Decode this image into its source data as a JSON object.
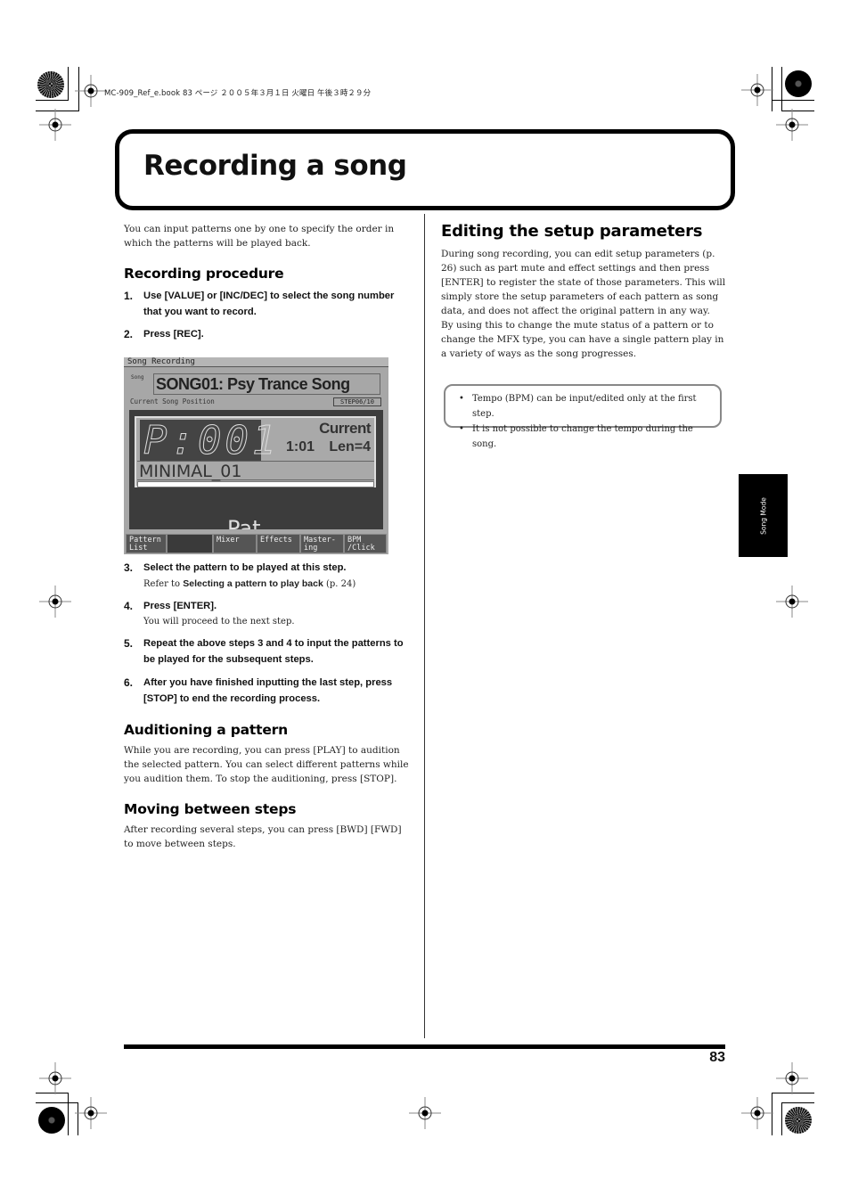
{
  "print_slug": "MC-909_Ref_e.book  83 ページ  ２００５年３月１日  火曜日  午後３時２９分",
  "title": "Recording a song",
  "left_column": {
    "intro": "You can input patterns one by one to specify the order in which the patterns will be played back.",
    "recording_procedure": {
      "heading": "Recording procedure",
      "steps_before_screen": [
        {
          "num": "1.",
          "text": "Use [VALUE] or [INC/DEC] to select the song number that you want to record."
        },
        {
          "num": "2.",
          "text": "Press [REC]."
        }
      ],
      "steps_after_screen": [
        {
          "num": "3.",
          "text": "Select the pattern to be played at this step.",
          "sub_prefix": "Refer to ",
          "sub_bold": "Selecting a pattern to play back",
          "sub_suffix": " (p. 24)"
        },
        {
          "num": "4.",
          "text": "Press [ENTER].",
          "sub": "You will proceed to the next step."
        },
        {
          "num": "5.",
          "text": "Repeat the above steps 3 and 4 to input the patterns to be played for the subsequent steps."
        },
        {
          "num": "6.",
          "text": "After you have finished inputting the last step, press [STOP] to end the recording process."
        }
      ]
    },
    "auditioning": {
      "heading": "Auditioning a pattern",
      "body": "While you are recording, you can press [PLAY] to audition the selected pattern. You can select different patterns while you audition them. To stop the auditioning, press [STOP]."
    },
    "moving": {
      "heading": "Moving between steps",
      "body": "After recording several steps, you can press [BWD] [FWD] to move between steps."
    }
  },
  "screen": {
    "header": "Song Recording",
    "song_label": "Song",
    "song_name": "SONG01: Psy Trance Song",
    "position_label": "Current Song Position",
    "step": "STEP06/10",
    "pattern_number": "P:001",
    "current_label": "Current",
    "measure_position": "1:01",
    "length": "Len=4",
    "pattern_name": "MINIMAL_01",
    "tabs": [
      {
        "label": "Pattern\nList"
      },
      {
        "label": ""
      },
      {
        "label": "Mixer"
      },
      {
        "label": "Effects"
      },
      {
        "label": "Master-\ning"
      },
      {
        "label": "BPM\n/Click"
      }
    ]
  },
  "right_column": {
    "heading": "Editing the setup parameters",
    "para1": "During song recording, you can edit setup parameters (p. 26) such as part mute and effect settings and then press [ENTER] to register the state of those parameters. This will simply store the setup parameters of each pattern as song data, and does not affect the original pattern in any way.",
    "para2": "By using this to change the mute status of a pattern or to change the MFX type, you can have a single pattern play in a variety of ways as the song progresses.",
    "notes": [
      "Tempo (BPM) can be input/edited only at the first step.",
      "It is not possible to change the tempo during the song."
    ]
  },
  "side_tab": "Song Mode",
  "page_number": "83"
}
